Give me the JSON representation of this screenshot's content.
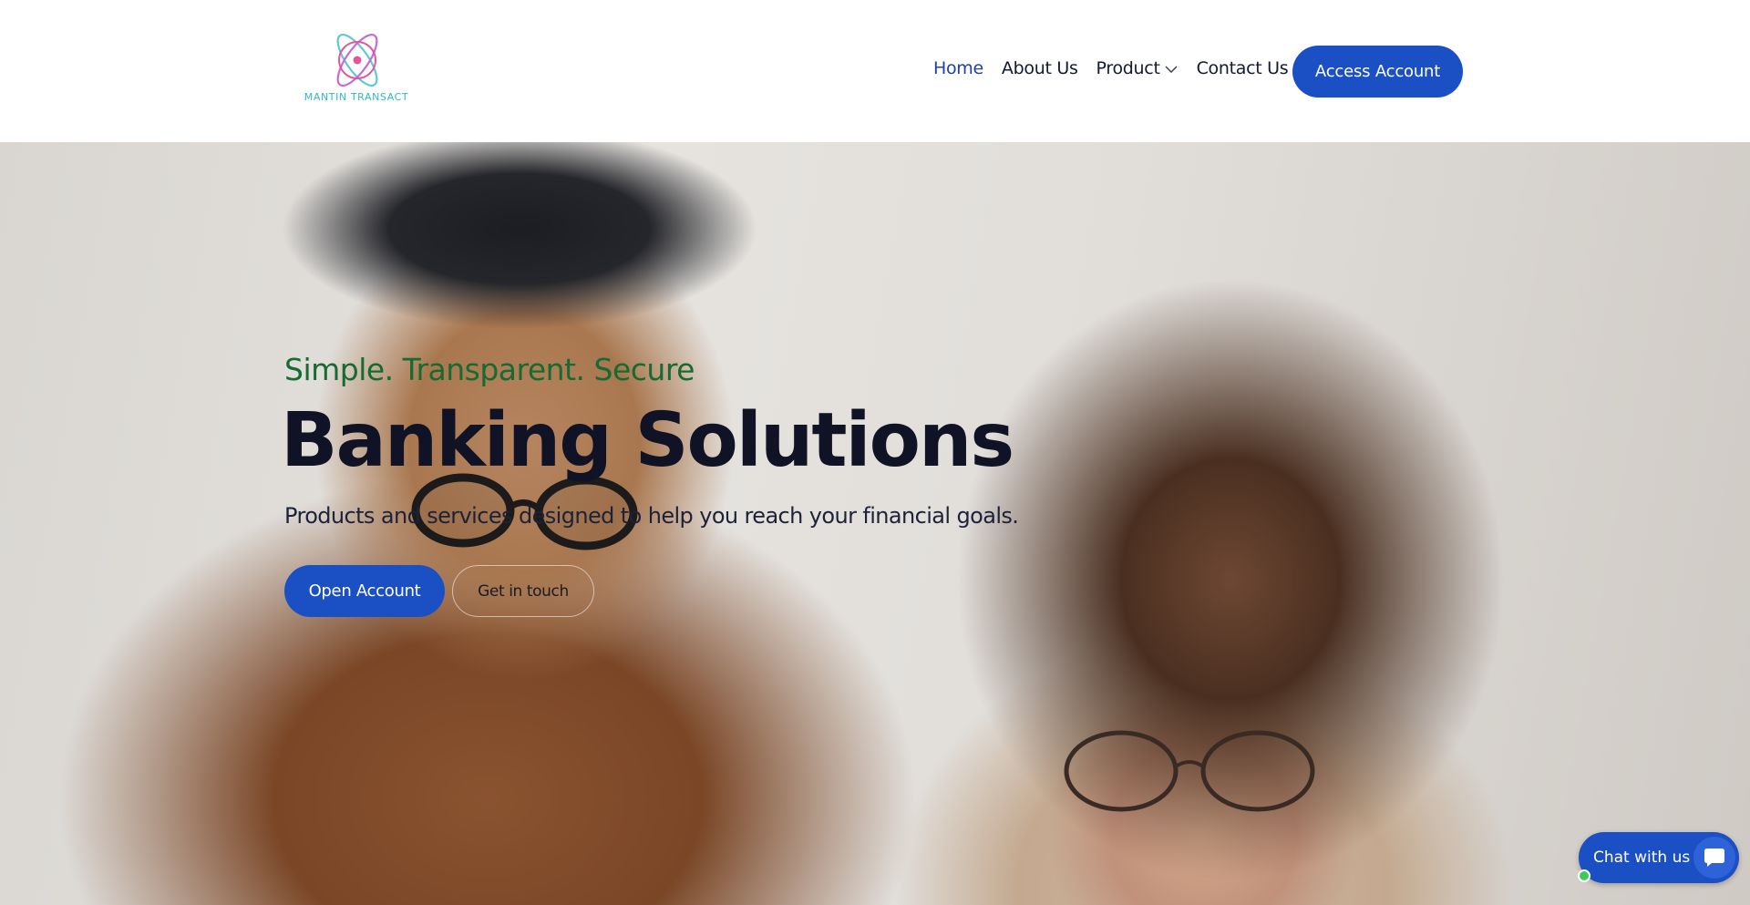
{
  "brand": {
    "logo_text": "MANTIN TRANSACT",
    "logo_icon": "atom-icon",
    "accent": "#1b4fc4",
    "tagline_color": "#156b31"
  },
  "nav": {
    "items": [
      {
        "label": "Home",
        "active": true
      },
      {
        "label": "About Us",
        "active": false
      },
      {
        "label": "Product",
        "active": false,
        "icon": "chevron-down-icon"
      },
      {
        "label": "Contact Us",
        "active": false
      }
    ],
    "cta_label": "Access Account"
  },
  "hero": {
    "tagline": "Simple. Transparent. Secure",
    "headline": "Banking Solutions",
    "subtitle": "Products and services designed to help you reach your financial goals.",
    "primary_button": "Open Account",
    "secondary_button": "Get in touch"
  },
  "chat": {
    "label": "Chat with us",
    "icon": "chat-bubble-icon",
    "status_color": "#3ccb5a"
  }
}
